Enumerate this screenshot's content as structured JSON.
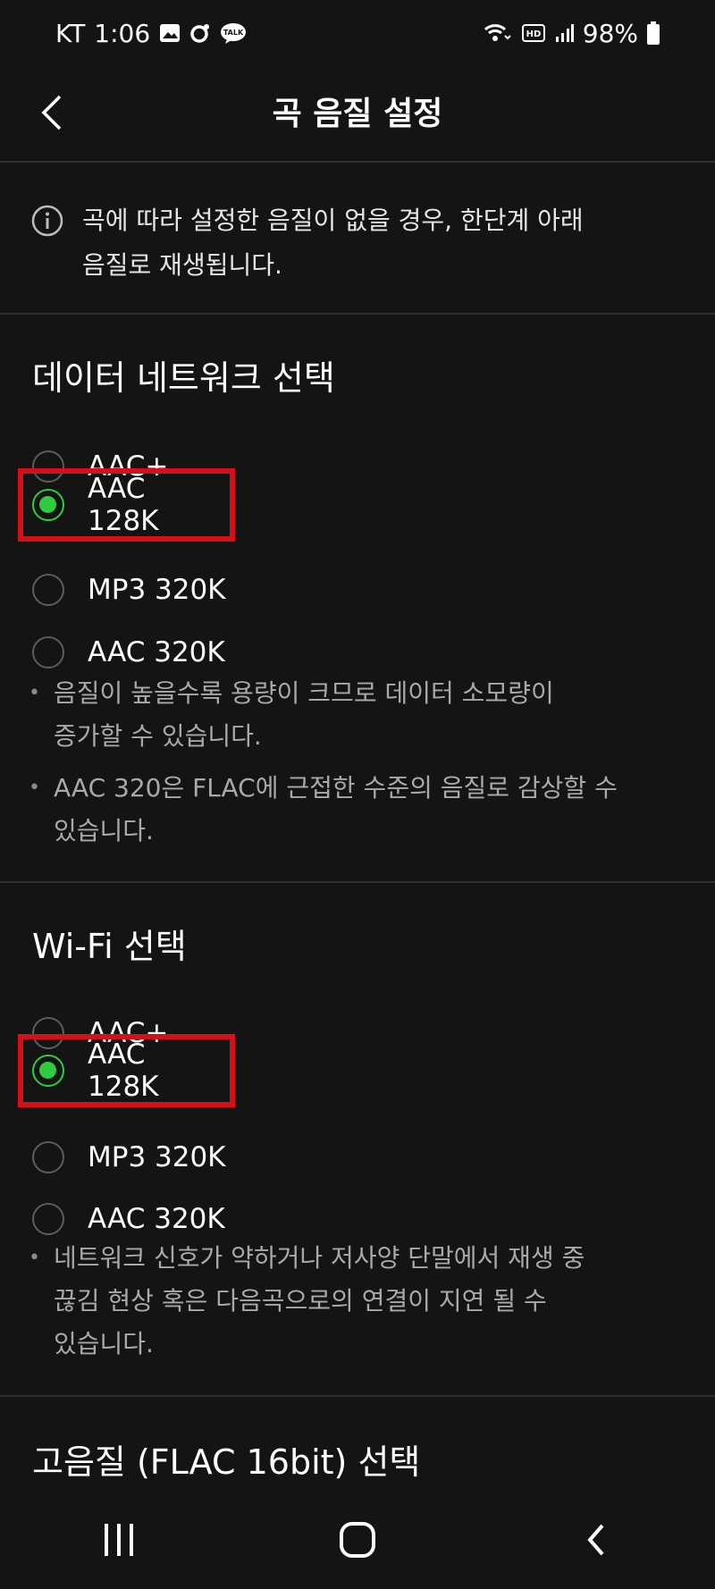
{
  "status_bar": {
    "carrier": "KT",
    "time": "1:06",
    "battery": "98%",
    "icons_left": [
      "gallery-icon",
      "notification-dot-icon",
      "talk-icon"
    ],
    "icons_right": [
      "wifi-calling-icon",
      "hd-icon",
      "signal-icon",
      "battery-icon"
    ]
  },
  "header": {
    "title": "곡 음질 설정"
  },
  "info": {
    "text_line1": "곡에 따라 설정한 음질이 없을 경우, 한단계 아래",
    "text_line2": "음질로 재생됩니다."
  },
  "data_network": {
    "title": "데이터 네트워크 선택",
    "options": [
      "AAC+",
      "AAC 128K",
      "MP3 320K",
      "AAC 320K"
    ],
    "selected": "AAC 128K",
    "notes": [
      {
        "l1": "음질이 높을수록 용량이 크므로 데이터 소모량이",
        "l2": "증가할 수 있습니다."
      },
      {
        "l1": "AAC 320은 FLAC에 근접한 수준의 음질로 감상할 수",
        "l2": "있습니다."
      }
    ]
  },
  "wifi": {
    "title": "Wi-Fi 선택",
    "options": [
      "AAC+",
      "AAC 128K",
      "MP3 320K",
      "AAC 320K"
    ],
    "selected": "AAC 128K",
    "notes": [
      {
        "l1": "네트워크 신호가 약하거나 저사양 단말에서 재생 중",
        "l2": "끊김 현상 혹은 다음곡으로의 연결이 지연 될 수",
        "l3": "있습니다."
      }
    ]
  },
  "hifi": {
    "title": "고음질 (FLAC 16bit) 선택"
  },
  "colors": {
    "accent": "#2ecc40",
    "highlight": "#d4101a",
    "background": "#141414"
  }
}
